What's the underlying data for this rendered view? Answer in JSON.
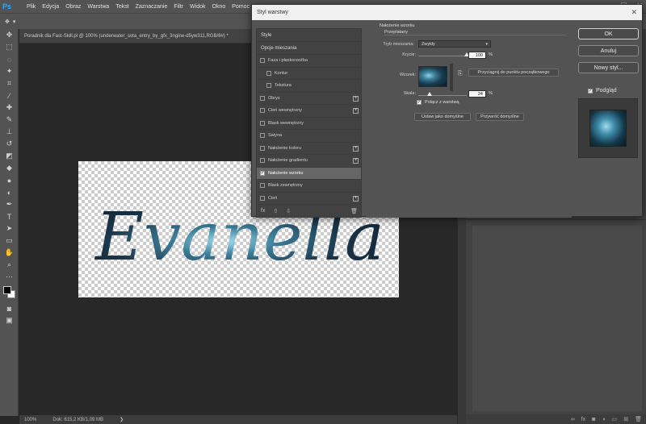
{
  "app": {
    "logo": "Ps",
    "menu": [
      "Plik",
      "Edycja",
      "Obraz",
      "Warstwa",
      "Tekst",
      "Zaznaczanie",
      "Filtr",
      "Widok",
      "Okno",
      "Pomoc"
    ],
    "window_controls": [
      "—",
      "☐",
      "✕"
    ]
  },
  "document": {
    "tab_title": "Poradnik dla Fast-Skill.pl @ 100% (underwater_sota_entry_by_gfx_3ngine-d5yw311,RGB/8#) *",
    "canvas_text": "Evanella",
    "zoom": "100%",
    "doc_size": "Dok: 615,2 KB/1,09 MB"
  },
  "dialog": {
    "title": "Styl warstwy",
    "close": "✕",
    "style_list_header": "Style",
    "blending_options": "Opcje mieszania",
    "styles": [
      {
        "label": "Faza i płaskorzeźba",
        "checked": false,
        "plus": false,
        "sub": false,
        "active": false
      },
      {
        "label": "Kontur",
        "checked": false,
        "plus": false,
        "sub": true,
        "active": false
      },
      {
        "label": "Tekstura",
        "checked": false,
        "plus": false,
        "sub": true,
        "active": false
      },
      {
        "label": "Obrys",
        "checked": false,
        "plus": true,
        "sub": false,
        "active": false
      },
      {
        "label": "Cień wewnętrzny",
        "checked": false,
        "plus": true,
        "sub": false,
        "active": false
      },
      {
        "label": "Blask wewnętrzny",
        "checked": false,
        "plus": false,
        "sub": false,
        "active": false
      },
      {
        "label": "Satyna",
        "checked": false,
        "plus": false,
        "sub": false,
        "active": false
      },
      {
        "label": "Nałożenie koloru",
        "checked": false,
        "plus": true,
        "sub": false,
        "active": false
      },
      {
        "label": "Nałożenie gradientu",
        "checked": false,
        "plus": true,
        "sub": false,
        "active": false
      },
      {
        "label": "Nałożenie wzorku",
        "checked": true,
        "plus": false,
        "sub": false,
        "active": true
      },
      {
        "label": "Blask zewnętrzny",
        "checked": false,
        "plus": false,
        "sub": false,
        "active": false
      },
      {
        "label": "Cień",
        "checked": false,
        "plus": true,
        "sub": false,
        "active": false
      }
    ],
    "footer_icons": {
      "fx": "fx",
      "up": "⇧",
      "down": "⇩",
      "trash": "🗑"
    },
    "pattern_overlay": {
      "heading": "Nałożenie wzorku",
      "subheading": "Przeplatany",
      "blend_mode_label": "Tryb mieszania:",
      "blend_mode_value": "Zwykły",
      "opacity_label": "Krycie:",
      "opacity_value": "100",
      "opacity_fraction": 1.0,
      "pattern_label": "Wzorek:",
      "snap_button": "Przyciągnij do punktu początkowego",
      "scale_label": "Skala:",
      "scale_value": "24",
      "scale_fraction": 0.24,
      "percent": "%",
      "link_label": "Połącz z warstwą",
      "link_checked": true,
      "make_default": "Ustaw jako domyślne",
      "reset_default": "Przywróć domyślne"
    },
    "buttons": {
      "ok": "OK",
      "cancel": "Anuluj",
      "new_style": "Nowy styl...",
      "preview": "Podgląd",
      "preview_checked": true
    }
  },
  "colors": {
    "accent_blue": "#31a8ff",
    "text_fill": "#1f3a52"
  }
}
